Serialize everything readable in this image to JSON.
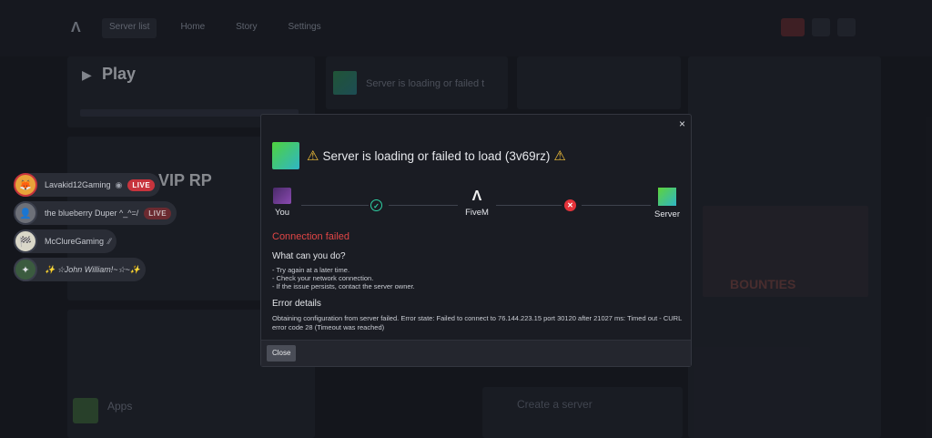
{
  "background": {
    "nav_items": [
      "Server list",
      "Home",
      "Story",
      "Settings"
    ],
    "play_label": "Play",
    "server_name_partial": "VIP RP",
    "loading_text": "Server is loading or failed t",
    "create_label": "Create a server",
    "apps_label": "Apps",
    "ad_text": "BOUNTIES"
  },
  "streams": [
    {
      "name": "Lavakid12Gaming",
      "icon": "eye-icon",
      "live": "LIVE",
      "italic": false
    },
    {
      "name": "the blueberry Duper ^_^=/",
      "icon": "",
      "live": "LIVE",
      "italic": false
    },
    {
      "name": "McClureGaming",
      "icon": "",
      "live": "",
      "italic": false
    },
    {
      "name": "✨ ☆John William!~☆~✨",
      "icon": "",
      "live": "",
      "italic": true
    }
  ],
  "modal": {
    "title": "Server is loading or failed to load (3v69rz)",
    "close_glyph": "×",
    "path": {
      "you_label": "You",
      "fivem_label": "FiveM",
      "server_label": "Server",
      "ok_glyph": "✓",
      "fail_glyph": "✕"
    },
    "error_title": "Connection failed",
    "what_heading": "What can you do?",
    "tips": [
      "- Try again at a later time.",
      "- Check your network connection.",
      "- If the issue persists, contact the server owner."
    ],
    "error_heading": "Error details",
    "error_details": "Obtaining configuration from server failed. Error state: Failed to connect to 76.144.223.15 port 30120 after 21027 ms: Timed out - CURL error code 28 (Timeout was reached)",
    "close_button": "Close"
  },
  "colors": {
    "error": "#e04646",
    "warning": "#f5c23a",
    "live": "#c7343d",
    "ok": "#2fd1a4"
  }
}
